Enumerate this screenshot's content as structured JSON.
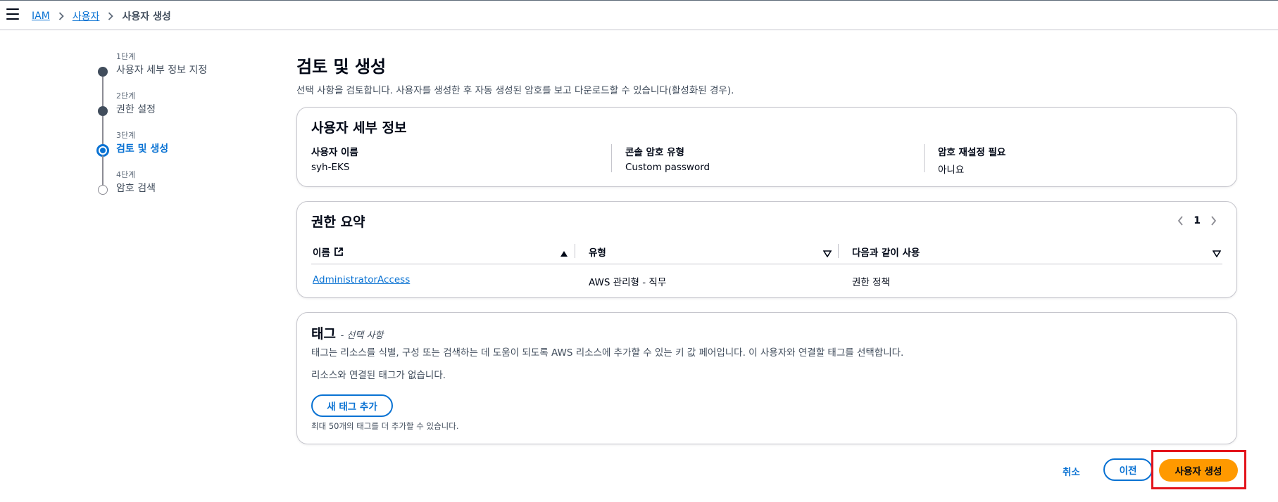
{
  "breadcrumb": {
    "items": [
      "IAM",
      "사용자"
    ],
    "current": "사용자 생성"
  },
  "steps": [
    {
      "num": "1단계",
      "label": "사용자 세부 정보 지정",
      "state": "done"
    },
    {
      "num": "2단계",
      "label": "권한 설정",
      "state": "done"
    },
    {
      "num": "3단계",
      "label": "검토 및 생성",
      "state": "active"
    },
    {
      "num": "4단계",
      "label": "암호 검색",
      "state": "pending"
    }
  ],
  "page": {
    "title": "검토 및 생성",
    "description": "선택 사항을 검토합니다. 사용자를 생성한 후 자동 생성된 암호를 보고 다운로드할 수 있습니다(활성화된 경우)."
  },
  "user_details": {
    "title": "사용자 세부 정보",
    "fields": [
      {
        "key": "사용자 이름",
        "value": "syh-EKS"
      },
      {
        "key": "콘솔 암호 유형",
        "value": "Custom password"
      },
      {
        "key": "암호 재설정 필요",
        "value": "아니요"
      }
    ]
  },
  "permissions": {
    "title": "권한 요약",
    "page": "1",
    "columns": [
      "이름",
      "유형",
      "다음과 같이 사용"
    ],
    "rows": [
      {
        "name": "AdministratorAccess",
        "type": "AWS 관리형 - 직무",
        "usage": "권한 정책"
      }
    ]
  },
  "tags": {
    "title": "태그",
    "optional": "- 선택 사항",
    "description": "태그는 리소스를 식별, 구성 또는 검색하는 데 도움이 되도록 AWS 리소스에 추가할 수 있는 키 값 페어입니다. 이 사용자와 연결할 태그를 선택합니다.",
    "empty": "리소스와 연결된 태그가 없습니다.",
    "add_button": "새 태그 추가",
    "hint": "최대 50개의 태그를 더 추가할 수 있습니다."
  },
  "actions": {
    "cancel": "취소",
    "previous": "이전",
    "create": "사용자 생성"
  },
  "colors": {
    "link": "#0972d3",
    "primary": "#ff9900",
    "highlight": "#e3141c"
  }
}
